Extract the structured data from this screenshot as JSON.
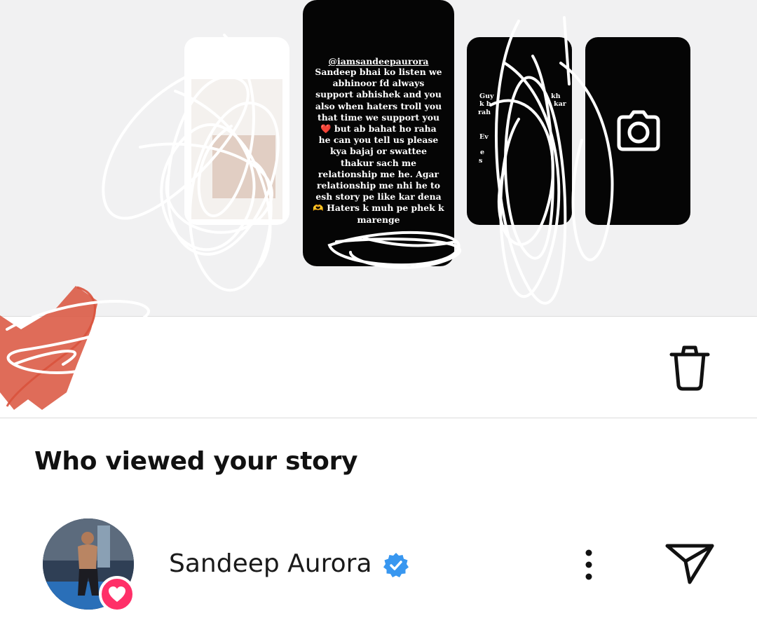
{
  "story_tray": {
    "active_story": {
      "handle": "@iamsandeepaurora",
      "lines": [
        "Sandeep bhai ko listen we",
        "abhinoor fd always",
        "support abhishek and you",
        "also when haters troll you",
        "that time we support you",
        "❤️ but ab bahat ho raha",
        "he can you tell us please",
        "kya bajaj or swattee",
        "thakur sach me",
        "relationship me he. Agar",
        "relationship me nhi he to",
        "esh story pe like kar dena",
        "🫶 Haters k muh pe phek k",
        "marenge"
      ]
    },
    "third_story_fragments": [
      "Guy",
      "kh",
      "k b",
      "kar",
      "rah",
      "Ev",
      "e",
      "s"
    ],
    "camera_icon": "camera-icon"
  },
  "actions": {
    "delete_icon": "trash-icon"
  },
  "viewers": {
    "title": "Who viewed your story",
    "items": [
      {
        "name": "Sandeep Aurora",
        "verified": true,
        "reaction": "heart-icon",
        "more_icon": "more-vertical-icon",
        "send_icon": "send-icon"
      }
    ]
  },
  "colors": {
    "tray_bg": "#f1f1f2",
    "story_bg": "#050505",
    "heart_badge": "#ff3068",
    "verified_blue": "#3897f0",
    "scribble_red": "#d9523c"
  }
}
